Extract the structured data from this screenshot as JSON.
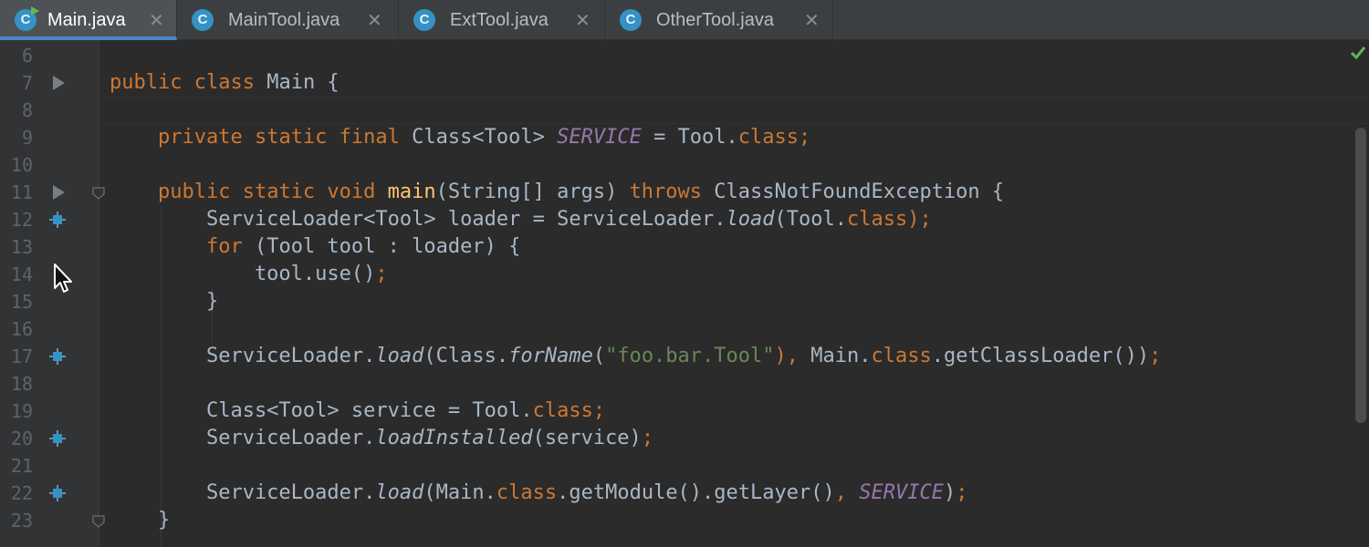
{
  "tabs": [
    {
      "label": "Main.java",
      "icon": "java-class-icon",
      "active": true,
      "runnable": true,
      "close": "✕"
    },
    {
      "label": "MainTool.java",
      "icon": "java-class-icon",
      "active": false,
      "close": "✕"
    },
    {
      "label": "ExtTool.java",
      "icon": "java-class-icon",
      "active": false,
      "close": "✕"
    },
    {
      "label": "OtherTool.java",
      "icon": "java-class-icon",
      "active": false,
      "close": "✕"
    }
  ],
  "file_icon_letter": "C",
  "line_numbers": [
    "6",
    "7",
    "8",
    "9",
    "10",
    "11",
    "12",
    "13",
    "14",
    "15",
    "16",
    "17",
    "18",
    "19",
    "20",
    "21",
    "22",
    "23"
  ],
  "run_gutter_lines": [
    "7",
    "11"
  ],
  "service_gutter_lines": [
    "12",
    "17",
    "20",
    "22"
  ],
  "fold_lines": [
    "11",
    "23"
  ],
  "code_lines": [
    [],
    [
      [
        "public ",
        "kw"
      ],
      [
        "class ",
        "kw"
      ],
      [
        "Main {",
        ""
      ]
    ],
    [],
    [
      [
        "    ",
        ""
      ],
      [
        "private ",
        "kw"
      ],
      [
        "static ",
        "kw"
      ],
      [
        "final ",
        "kw"
      ],
      [
        "Class<Tool> ",
        ""
      ],
      [
        "SERVICE",
        "st"
      ],
      [
        " = Tool.",
        ""
      ],
      [
        "class",
        "kw"
      ],
      [
        ";",
        "kw"
      ]
    ],
    [],
    [
      [
        "    ",
        ""
      ],
      [
        "public ",
        "kw"
      ],
      [
        "static ",
        "kw"
      ],
      [
        "void ",
        "kw"
      ],
      [
        "main",
        "fn"
      ],
      [
        "(String[] args) ",
        ""
      ],
      [
        "throws ",
        "kw"
      ],
      [
        "ClassNotFoundException {",
        ""
      ]
    ],
    [
      [
        "        ServiceLoader<Tool> loader = ServiceLoader.",
        ""
      ],
      [
        "load",
        "it"
      ],
      [
        "(Tool.",
        ""
      ],
      [
        "class",
        "kw"
      ],
      [
        ");",
        "kw"
      ]
    ],
    [
      [
        "        ",
        ""
      ],
      [
        "for ",
        "kw"
      ],
      [
        "(Tool tool : loader) {",
        ""
      ]
    ],
    [
      [
        "            tool.use()",
        ""
      ],
      [
        ";",
        "kw"
      ]
    ],
    [
      [
        "        }",
        ""
      ]
    ],
    [],
    [
      [
        "        ServiceLoader.",
        ""
      ],
      [
        "load",
        "it"
      ],
      [
        "(Class.",
        ""
      ],
      [
        "forName",
        "it"
      ],
      [
        "(",
        ""
      ],
      [
        "\"foo.bar.Tool\"",
        "str"
      ],
      [
        "), ",
        "kw"
      ],
      [
        "Main.",
        ""
      ],
      [
        "class",
        "kw"
      ],
      [
        ".getClassLoader())",
        ""
      ],
      [
        ";",
        "kw"
      ]
    ],
    [],
    [
      [
        "        Class<Tool> service = Tool.",
        ""
      ],
      [
        "class",
        "kw"
      ],
      [
        ";",
        "kw"
      ]
    ],
    [
      [
        "        ServiceLoader.",
        ""
      ],
      [
        "loadInstalled",
        "it"
      ],
      [
        "(service)",
        ""
      ],
      [
        ";",
        "kw"
      ]
    ],
    [],
    [
      [
        "        ServiceLoader.",
        ""
      ],
      [
        "load",
        "it"
      ],
      [
        "(Main.",
        ""
      ],
      [
        "class",
        "kw"
      ],
      [
        ".getModule().getLayer()",
        ""
      ],
      [
        ", ",
        "kw"
      ],
      [
        "SERVICE",
        "st"
      ],
      [
        ")",
        ""
      ],
      [
        ";",
        "kw"
      ]
    ],
    [
      [
        "    }",
        ""
      ]
    ]
  ],
  "colors": {
    "background": "#2b2b2b",
    "gutter": "#313335",
    "keyword": "#cc7832",
    "method_declaration": "#ffc66d",
    "static_field": "#9876aa",
    "string": "#6a8759",
    "text": "#a9b7c6",
    "line_number": "#606366",
    "active_tab_underline": "#4a88c7"
  },
  "status": {
    "inspection_icon": "checkmark-icon",
    "inspection_state": "no-problems"
  }
}
